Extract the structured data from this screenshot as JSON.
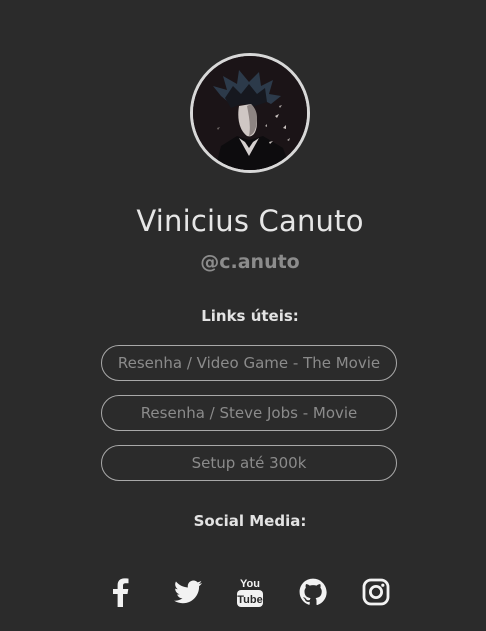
{
  "profile": {
    "name": "Vinicius Canuto",
    "handle": "@c.anuto"
  },
  "links": {
    "title": "Links úteis:",
    "items": [
      {
        "label": "Resenha / Video Game - The Movie"
      },
      {
        "label": "Resenha / Steve Jobs - Movie"
      },
      {
        "label": "Setup até 300k"
      }
    ]
  },
  "social": {
    "title": "Social Media:",
    "icons": [
      {
        "name": "facebook-icon"
      },
      {
        "name": "twitter-icon"
      },
      {
        "name": "youtube-icon"
      },
      {
        "name": "github-icon"
      },
      {
        "name": "instagram-icon"
      }
    ]
  },
  "colors": {
    "background": "#2b2b2b",
    "text": "#e3e3e3",
    "muted": "#8b8b8b",
    "border": "#a9a9a9"
  }
}
